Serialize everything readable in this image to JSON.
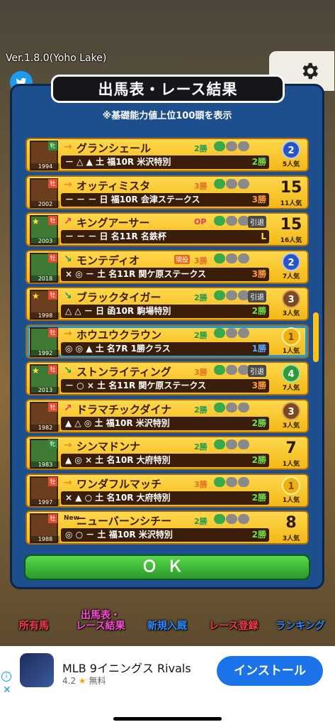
{
  "version": "Ver.1.8.0(Yoho Lake)",
  "title": "出馬表・レース結果",
  "subtitle": "※基礎能力値上位100頭を表示",
  "rows": [
    {
      "year": "1994",
      "sex": "牝",
      "star": false,
      "arrow": "→",
      "arrowType": "right",
      "name": "グランシェール",
      "grade": "2勝",
      "gradeType": "g2",
      "genyaku": "",
      "intai": "",
      "marks": "－ △ ▲",
      "day": "土",
      "race": "福10R 米沢特別",
      "wins": "2勝",
      "winsType": "c2",
      "rankType": "badge",
      "rank": "2",
      "badge": "blue",
      "pop": "5人気",
      "avatar": "brown"
    },
    {
      "year": "2002",
      "sex": "牡",
      "star": false,
      "arrow": "→",
      "arrowType": "right",
      "name": "オッティミスタ",
      "grade": "3勝",
      "gradeType": "g3",
      "genyaku": "",
      "intai": "",
      "marks": "－ － －",
      "day": "日",
      "race": "福10R 会津ステークス",
      "wins": "3勝",
      "winsType": "c3",
      "rankType": "num",
      "rank": "15",
      "badge": "",
      "pop": "11人気",
      "avatar": "brown"
    },
    {
      "year": "2003",
      "sex": "牡",
      "star": true,
      "arrow": "↗",
      "arrowType": "up",
      "name": "キングアーサー",
      "grade": "OP",
      "gradeType": "op",
      "genyaku": "",
      "intai": "引退",
      "marks": "－ － －",
      "day": "日",
      "race": "名11R 名鉄杯",
      "wins": "L",
      "winsType": "cl",
      "rankType": "num",
      "rank": "15",
      "badge": "",
      "pop": "16人気",
      "avatar": "green"
    },
    {
      "year": "2018",
      "sex": "牡",
      "star": false,
      "arrow": "↘",
      "arrowType": "down",
      "name": "モンテディオ",
      "grade": "3勝",
      "gradeType": "g3",
      "genyaku": "現役",
      "intai": "",
      "marks": "× ◎ －",
      "day": "土",
      "race": "名11R 関ケ原ステークス",
      "wins": "3勝",
      "winsType": "c3",
      "rankType": "badge",
      "rank": "2",
      "badge": "blue",
      "pop": "7人気",
      "avatar": "green"
    },
    {
      "year": "1998",
      "sex": "牡",
      "star": true,
      "arrow": "↘",
      "arrowType": "down",
      "name": "ブラックタイガー",
      "grade": "2勝",
      "gradeType": "g2",
      "genyaku": "",
      "intai": "引退",
      "marks": "△ △ －",
      "day": "日",
      "race": "函10R 駒場特別",
      "wins": "2勝",
      "winsType": "c2",
      "rankType": "badge",
      "rank": "3",
      "badge": "bronze",
      "pop": "3人気",
      "avatar": "brown"
    },
    {
      "year": "1992",
      "sex": "牡",
      "star": false,
      "arrow": "→",
      "arrowType": "right",
      "name": "ホウユウクラウン",
      "grade": "2勝",
      "gradeType": "g2",
      "genyaku": "",
      "intai": "",
      "marks": "◎ ◎ ▲",
      "day": "土",
      "race": "名7R  1勝クラス",
      "wins": "1勝",
      "winsType": "c1",
      "rankType": "badge",
      "rank": "1",
      "badge": "gold",
      "pop": "1人気",
      "avatar": "green",
      "selected": true
    },
    {
      "year": "2013",
      "sex": "牡",
      "star": true,
      "arrow": "↘",
      "arrowType": "down",
      "name": "ストンライティング",
      "grade": "3勝",
      "gradeType": "g3",
      "genyaku": "",
      "intai": "引退",
      "marks": "－ ○ ×",
      "day": "土",
      "race": "名11R 関ケ原ステークス",
      "wins": "3勝",
      "winsType": "c3",
      "rankType": "badge",
      "rank": "4",
      "badge": "green",
      "pop": "7人気",
      "avatar": "green"
    },
    {
      "year": "1982",
      "sex": "牡",
      "star": false,
      "arrow": "↗",
      "arrowType": "up",
      "name": "ドラマチックダイナ",
      "grade": "2勝",
      "gradeType": "g2",
      "genyaku": "",
      "intai": "",
      "marks": "▲ △ ◎",
      "day": "土",
      "race": "福10R 米沢特別",
      "wins": "2勝",
      "winsType": "c2",
      "rankType": "badge",
      "rank": "3",
      "badge": "bronze",
      "pop": "3人気",
      "avatar": "brown"
    },
    {
      "year": "1983",
      "sex": "牝",
      "star": false,
      "arrow": "→",
      "arrowType": "right",
      "name": "シンマドンナ",
      "grade": "2勝",
      "gradeType": "g2",
      "genyaku": "",
      "intai": "",
      "marks": "▲ ◎ ×",
      "day": "土",
      "race": "名10R 大府特別",
      "wins": "2勝",
      "winsType": "c2",
      "rankType": "num",
      "rank": "7",
      "badge": "",
      "pop": "1人気",
      "avatar": "green"
    },
    {
      "year": "1997",
      "sex": "牡",
      "star": false,
      "arrow": "→",
      "arrowType": "right",
      "name": "ワンダフルマッチ",
      "grade": "3勝",
      "gradeType": "g3",
      "genyaku": "",
      "intai": "",
      "marks": "× ▲ ○",
      "day": "土",
      "race": "名10R 大府特別",
      "wins": "2勝",
      "winsType": "c2",
      "rankType": "badge",
      "rank": "1",
      "badge": "gold",
      "pop": "1人気",
      "avatar": "brown"
    },
    {
      "year": "1988",
      "sex": "牡",
      "star": false,
      "arrow": "",
      "arrowType": "new",
      "name": "ニューバーンシチー",
      "grade": "2勝",
      "gradeType": "g2",
      "genyaku": "",
      "intai": "",
      "marks": "◎ ○ －",
      "day": "土",
      "race": "福10R 米沢特別",
      "wins": "2勝",
      "winsType": "c2",
      "rankType": "num",
      "rank": "8",
      "badge": "",
      "pop": "3人気",
      "avatar": "brown",
      "newLabel": "New"
    }
  ],
  "ok_label": "ＯＫ",
  "nav": [
    {
      "label": "所有馬",
      "color": "red"
    },
    {
      "label": "出馬表・\nレース結果",
      "color": "pink"
    },
    {
      "label": "新規入厩",
      "color": "blue"
    },
    {
      "label": "レース登録",
      "color": "red"
    },
    {
      "label": "ランキング",
      "color": "blue"
    }
  ],
  "ad": {
    "title": "MLB 9イニングス Rivals",
    "rating": "4.2",
    "price": "無料",
    "button": "インストール"
  }
}
